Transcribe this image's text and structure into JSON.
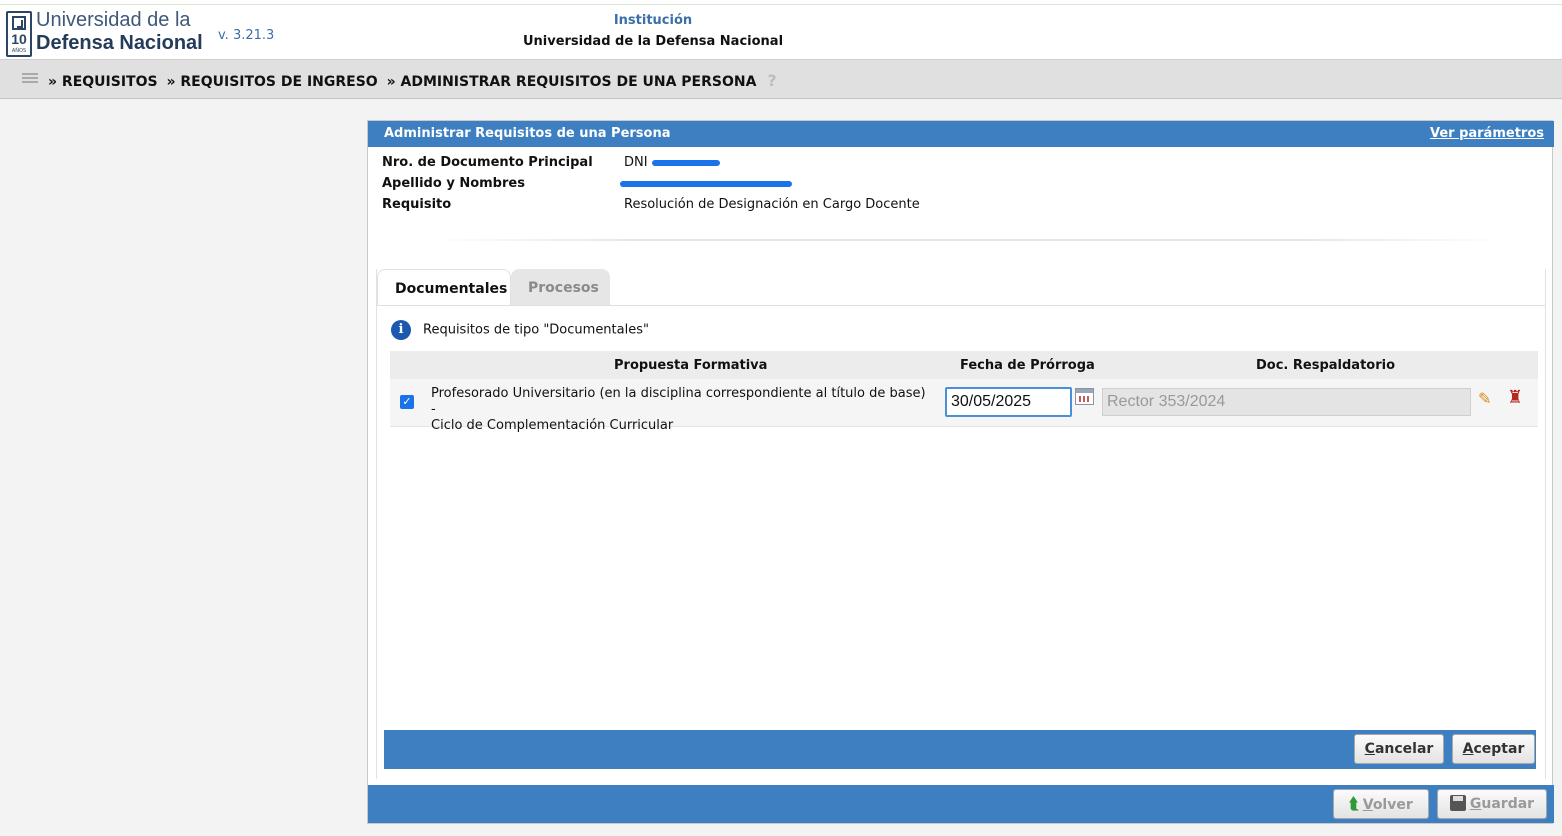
{
  "header": {
    "logo_line1": "Universidad de la",
    "logo_line2": "Defensa Nacional",
    "logo_number": "10",
    "logo_years": "AÑOS",
    "version": "v. 3.21.3",
    "institution_label": "Institución",
    "institution_name": "Universidad de la Defensa Nacional"
  },
  "breadcrumb": {
    "items": [
      "» REQUISITOS",
      "» REQUISITOS DE INGRESO",
      "» ADMINISTRAR REQUISITOS DE UNA PERSONA"
    ],
    "help": "?"
  },
  "panel": {
    "title": "Administrar Requisitos de una Persona",
    "params_link": "Ver parámetros",
    "fields": [
      {
        "label": "Nro. de Documento Principal",
        "value": "DNI"
      },
      {
        "label": "Apellido y Nombres",
        "value": ""
      },
      {
        "label": "Requisito",
        "value": "Resolución de Designación en Cargo Docente"
      }
    ]
  },
  "tabs": [
    {
      "label": "Documentales",
      "active": true
    },
    {
      "label": "Procesos",
      "active": false
    }
  ],
  "info_message": "Requisitos de tipo \"Documentales\"",
  "grid": {
    "columns": [
      "Propuesta Formativa",
      "Fecha de Prórroga",
      "Doc. Respaldatorio"
    ],
    "rows": [
      {
        "checked": true,
        "propuesta_line1": "Profesorado Universitario (en la disciplina correspondiente al título de base) -",
        "propuesta_line2": "Ciclo de Complementación Curricular",
        "fecha": "30/05/2025",
        "doc": "Rector 353/2024"
      }
    ]
  },
  "dialog_buttons": {
    "cancel_label": "ancelar",
    "cancel_key": "C",
    "accept_label": "ceptar",
    "accept_key": "A"
  },
  "footer_buttons": {
    "back_label": "olver",
    "back_key": "V",
    "save_label": "uardar",
    "save_key": "G"
  },
  "colors": {
    "accent": "#3d7fc1",
    "navbar": "#e0e0e0"
  }
}
